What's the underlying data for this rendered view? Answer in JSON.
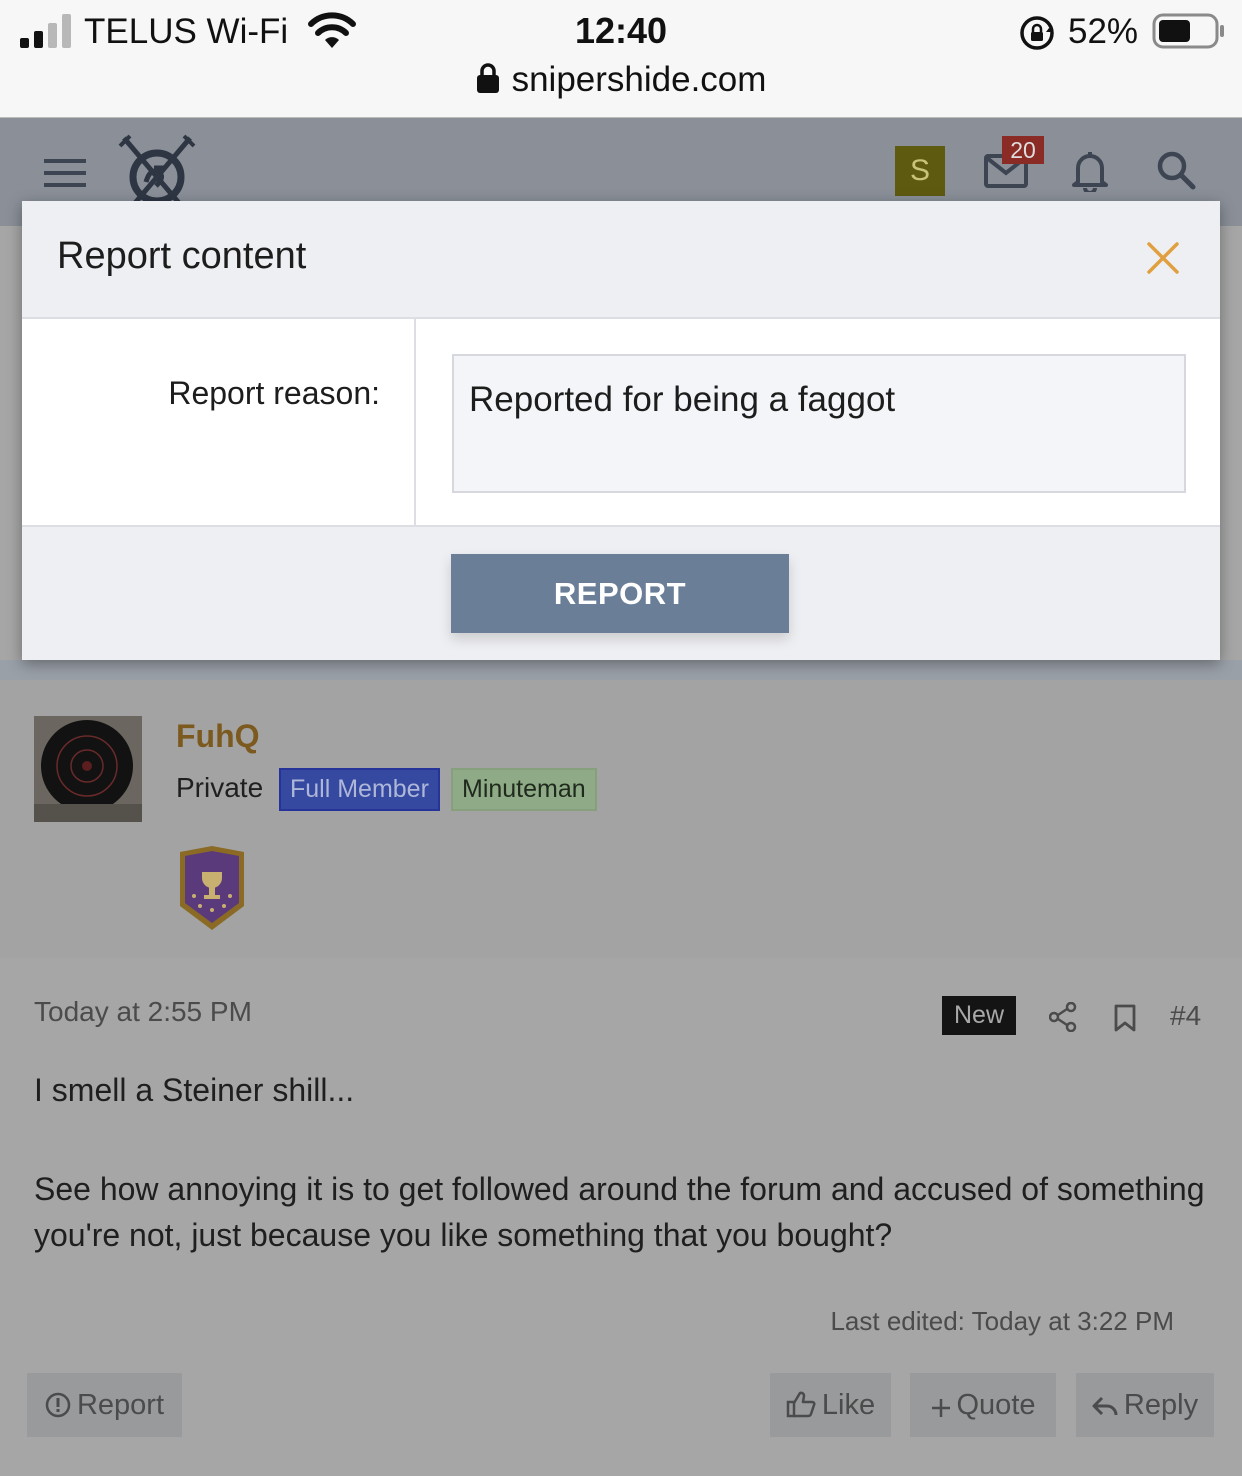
{
  "status_bar": {
    "carrier": "TELUS Wi-Fi",
    "time": "12:40",
    "battery_percent": "52%",
    "url": "snipershide.com",
    "icons": [
      "signal-icon",
      "wifi-icon",
      "rotation-lock-icon",
      "battery-icon",
      "lock-icon"
    ]
  },
  "header": {
    "avatar_letter": "S",
    "mail_count": "20",
    "icons": [
      "menu-icon",
      "site-logo",
      "mail-icon",
      "bell-icon",
      "search-icon"
    ]
  },
  "modal": {
    "title": "Report content",
    "reason_label": "Report reason:",
    "reason_value": "Reported for being a faggot",
    "submit_label": "REPORT",
    "accent_color": "#e0a040",
    "button_color": "#6a7e98"
  },
  "post": {
    "username": "FuhQ",
    "user_title": "Private",
    "badges": [
      "Full Member",
      "Minuteman"
    ],
    "date": "Today at 2:55 PM",
    "new_tag": "New",
    "post_number": "#4",
    "line1": "I smell a Steiner shill...",
    "line2": "See how annoying it is to get followed around the forum and accused of something you're not, just because you like something that you bought?",
    "last_edited": "Last edited: Today at 3:22 PM",
    "actions": {
      "report": "Report",
      "like": "Like",
      "quote": "Quote",
      "reply": "Reply"
    }
  }
}
